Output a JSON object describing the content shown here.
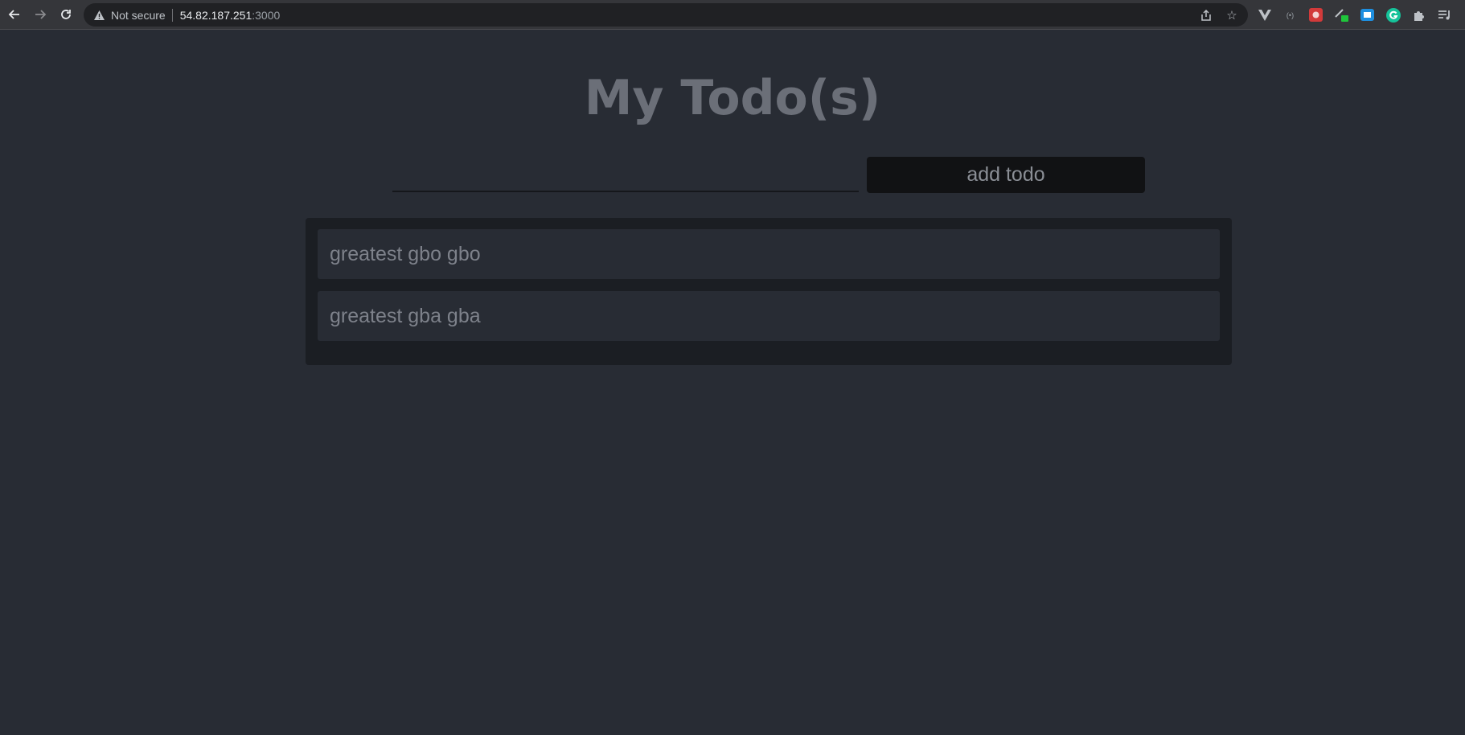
{
  "browser": {
    "security_label": "Not secure",
    "url_host": "54.82.187.251",
    "url_port": ":3000"
  },
  "page": {
    "title": "My Todo(s)",
    "input": {
      "value": "",
      "placeholder": ""
    },
    "add_button_label": "add todo",
    "todos": [
      {
        "text": "greatest gbo gbo"
      },
      {
        "text": "greatest gba gba"
      }
    ]
  },
  "colors": {
    "background": "#282c34",
    "list_background": "#1b1e23",
    "button_background": "#111214",
    "title": "#6b6f78"
  }
}
